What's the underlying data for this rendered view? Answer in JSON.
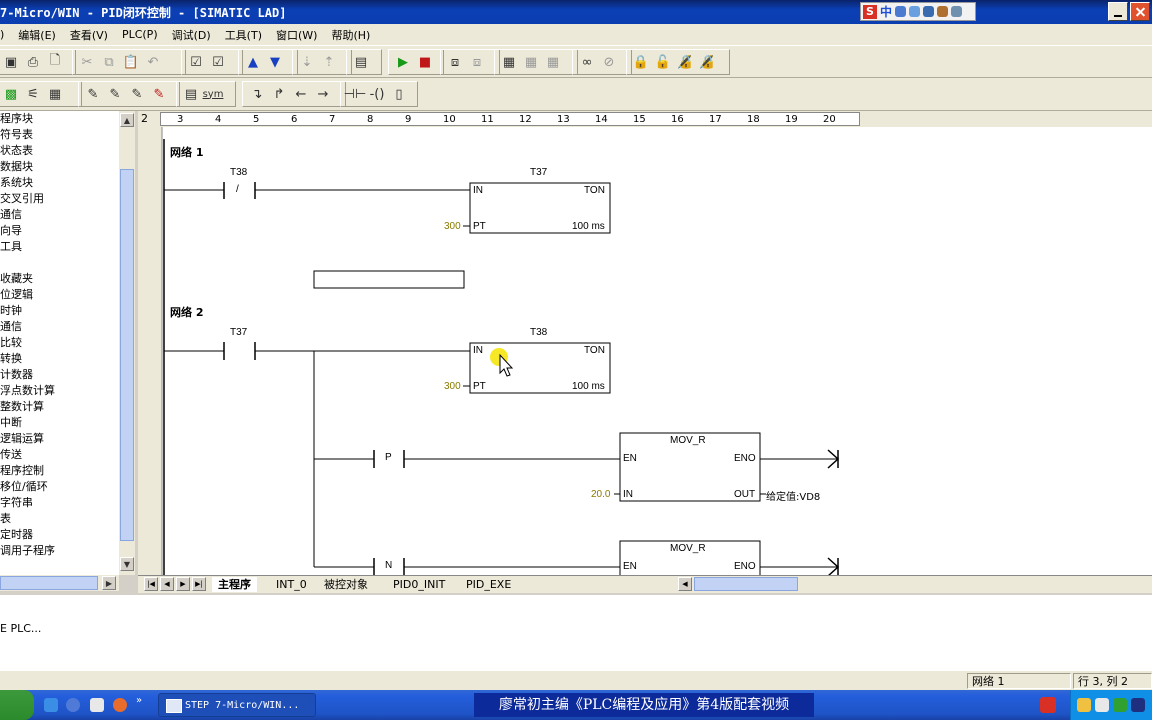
{
  "window": {
    "title": "7-Micro/WIN - PID闭环控制 - [SIMATIC LAD]",
    "ime_label": "中"
  },
  "menu": [
    "编辑(E)",
    "查看(V)",
    "PLC(P)",
    "调试(D)",
    "工具(T)",
    "窗口(W)",
    "帮助(H)"
  ],
  "toolbar2": {
    "sym_label": "sym"
  },
  "tree": {
    "items": [
      "程序块",
      "符号表",
      "状态表",
      "数据块",
      "系统块",
      "交叉引用",
      "通信",
      "向导",
      "工具",
      "",
      "收藏夹",
      "位逻辑",
      "时钟",
      "通信",
      "比较",
      "转换",
      "计数器",
      "浮点数计算",
      "整数计算",
      "中断",
      "逻辑运算",
      "传送",
      "程序控制",
      "移位/循环",
      "字符串",
      "表",
      "定时器",
      "调用子程序"
    ]
  },
  "ruler": {
    "left_num": "2",
    "ticks": [
      "3",
      "4",
      "5",
      "6",
      "7",
      "8",
      "9",
      "10",
      "11",
      "12",
      "13",
      "14",
      "15",
      "16",
      "17",
      "18",
      "19",
      "20"
    ]
  },
  "ladder": {
    "network1": {
      "label": "网络 1",
      "contact": "T38",
      "contact_symbol": "/",
      "timer_name": "T37",
      "timer_type": "TON",
      "in_label": "IN",
      "pt_label": "PT",
      "pt_value": "300",
      "base": "100 ms"
    },
    "network2": {
      "label": "网络 2",
      "contact": "T37",
      "timer_name": "T38",
      "timer_type": "TON",
      "in_label": "IN",
      "pt_label": "PT",
      "pt_value": "300",
      "base": "100 ms",
      "p_contact": "P",
      "n_contact": "N",
      "mov1": {
        "name": "MOV_R",
        "en": "EN",
        "eno": "ENO",
        "in": "IN",
        "out": "OUT",
        "in_value": "20.0",
        "out_value": "给定值:VD8"
      },
      "mov2": {
        "name": "MOV_R",
        "en": "EN",
        "eno": "ENO"
      }
    }
  },
  "tabs": [
    "主程序",
    "INT_0",
    "被控对象",
    "PID0_INIT",
    "PID_EXE"
  ],
  "output": {
    "text": "E PLC..."
  },
  "status": {
    "network": "网络 1",
    "position": "行 3, 列 2"
  },
  "taskbar": {
    "app": "STEP 7-Micro/WIN...",
    "banner": "廖常初主编《PLC编程及应用》第4版配套视频"
  },
  "colors": {
    "title_bar": "#0b3fb4",
    "pt_value": "#8a7a00",
    "cursor_highlight": "#f5e400"
  }
}
